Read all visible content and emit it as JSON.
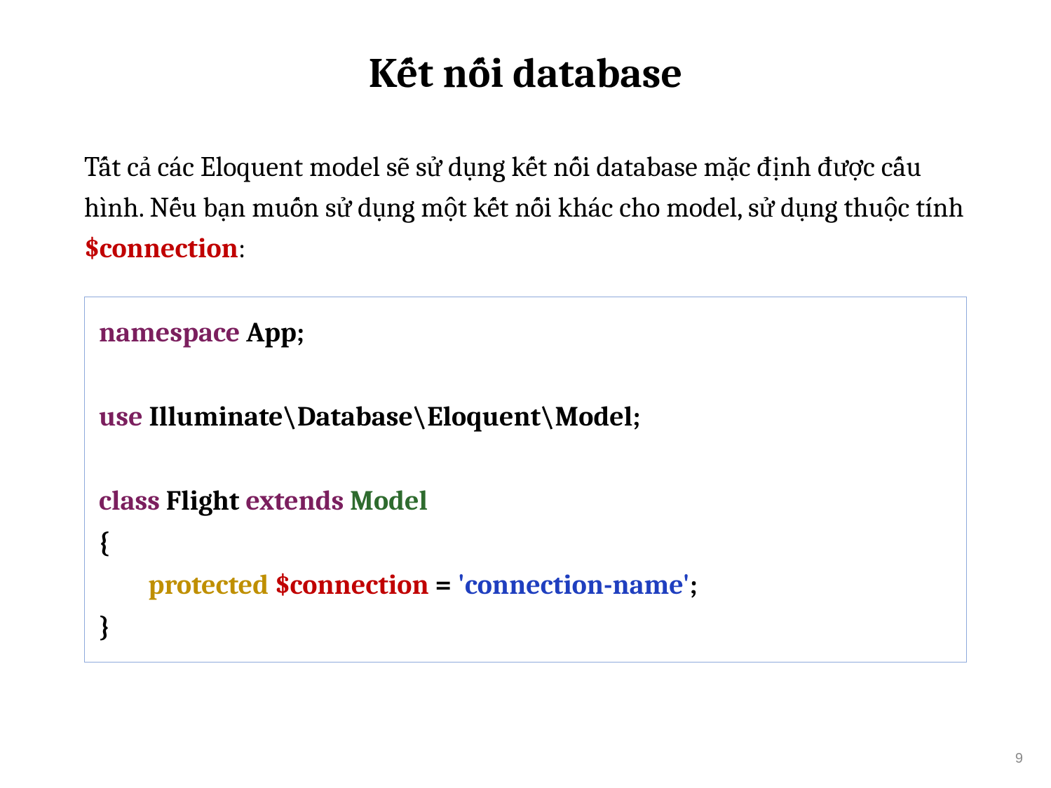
{
  "title": "Kết nối database",
  "body": {
    "text_before": "Tất cả các Eloquent model sẽ sử dụng kết nối database mặc định được cấu hình. Nếu bạn muốn sử dụng một kết nối khác cho model, sử dụng thuộc tính ",
    "keyword": "$connection",
    "text_after": ":"
  },
  "code": {
    "kw_namespace": "namespace",
    "ns_name": " App;",
    "blank": "",
    "kw_use": "use",
    "use_path": " Illuminate\\Database\\Eloquent\\Model;",
    "kw_class": "class",
    "class_mid": " Flight ",
    "kw_extends": "extends",
    "space": " ",
    "class_name": "Model",
    "brace_open": "{",
    "indent": "        ",
    "kw_protected": "protected",
    "var_name": " $connection",
    "assign": " = ",
    "str_value": "'connection-name'",
    "semicolon": ";",
    "brace_close": "}"
  },
  "page_number": "9"
}
